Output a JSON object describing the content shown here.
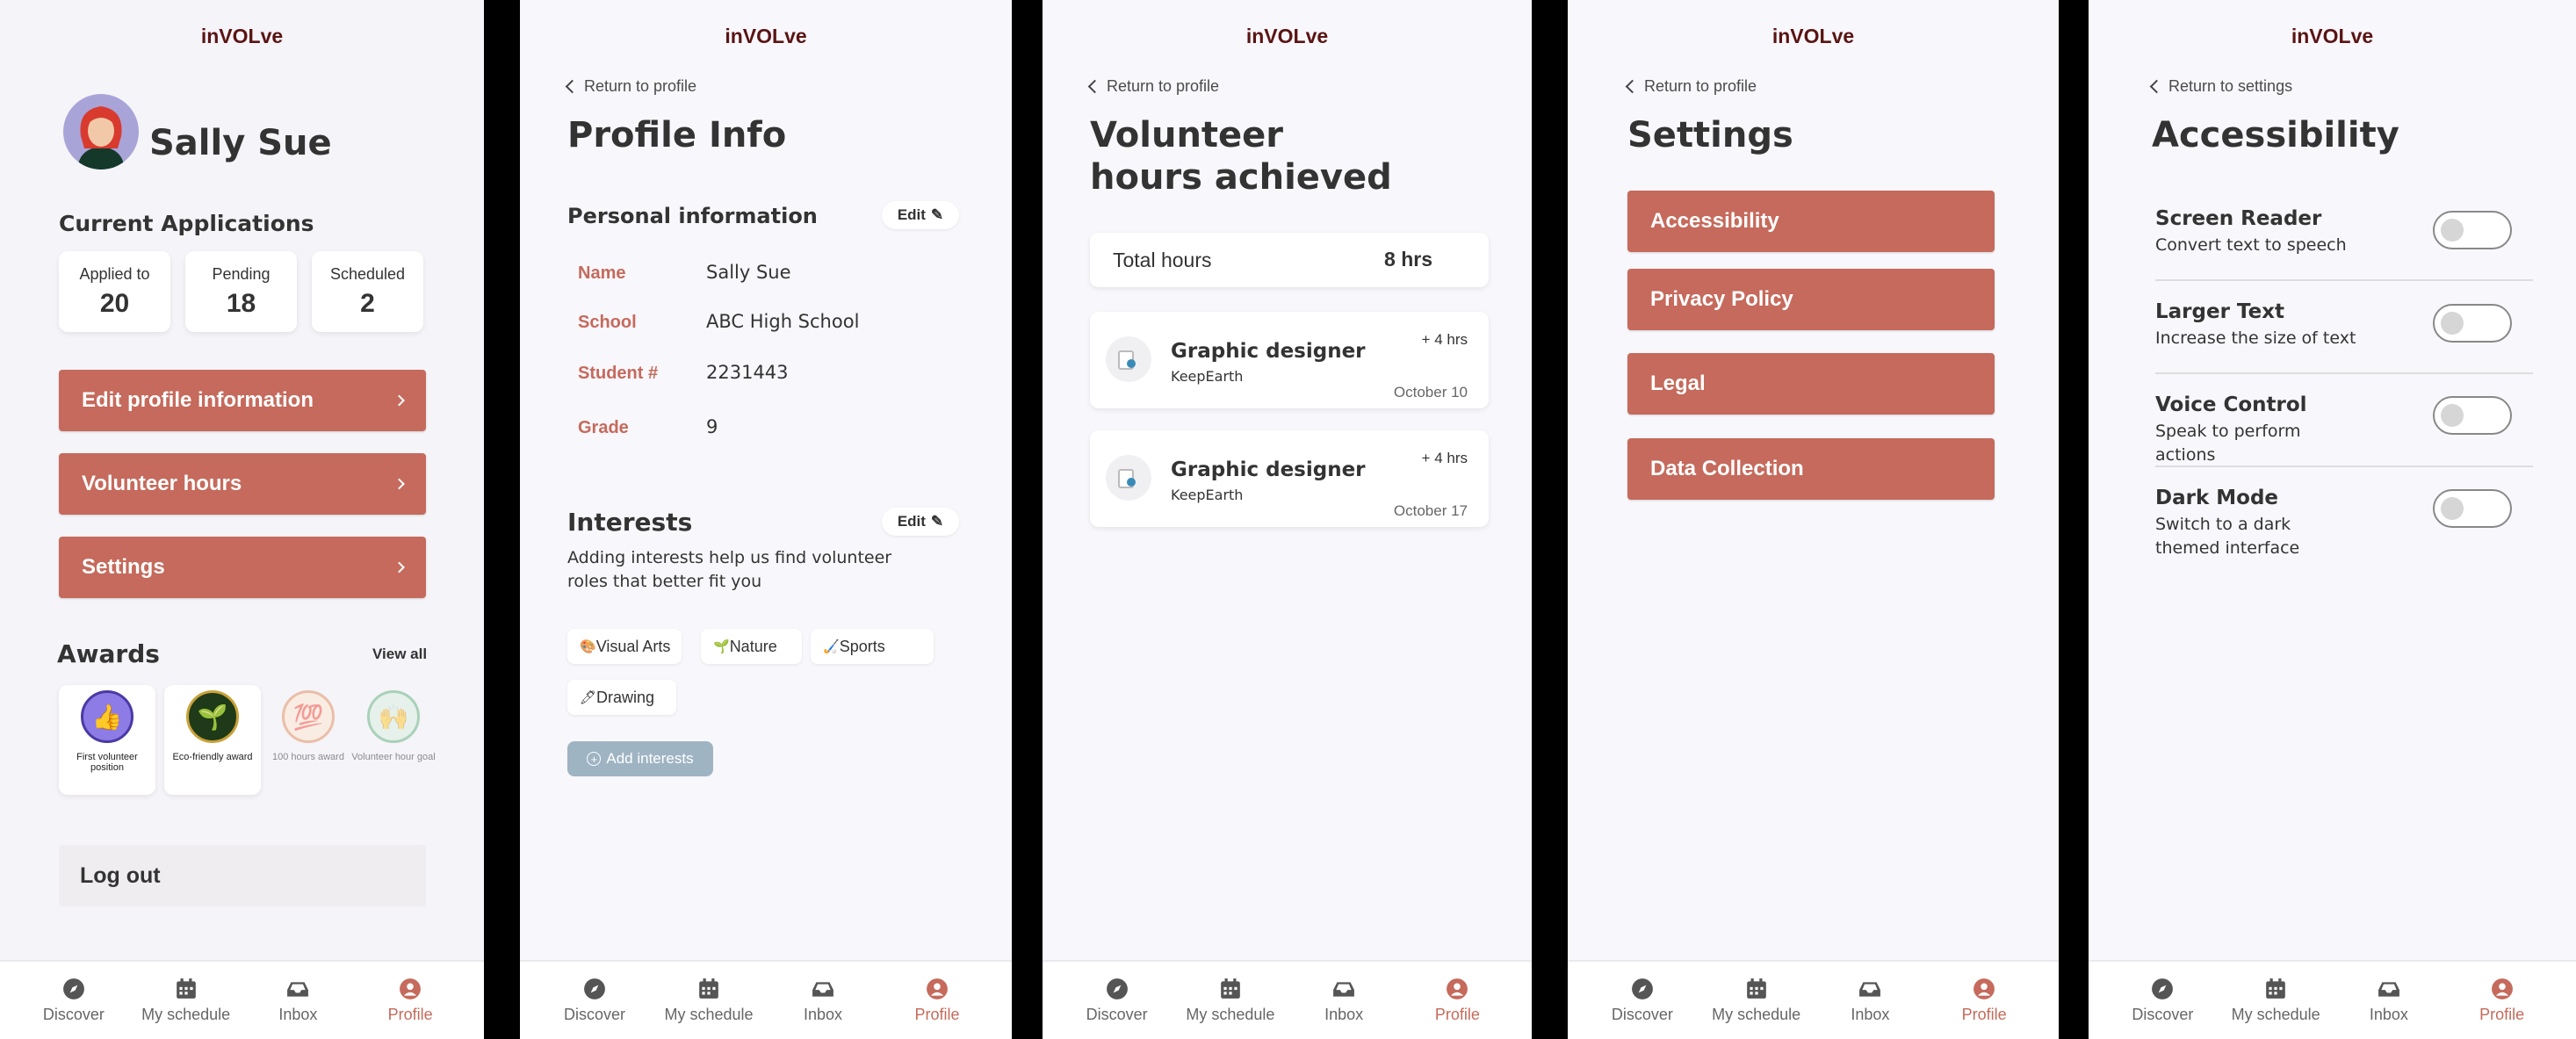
{
  "app_title": "inVOLve",
  "tabs": [
    {
      "label": "Discover",
      "icon": "compass-icon"
    },
    {
      "label": "My schedule",
      "icon": "calendar-icon"
    },
    {
      "label": "Inbox",
      "icon": "inbox-icon"
    },
    {
      "label": "Profile",
      "icon": "user-icon"
    }
  ],
  "colors": {
    "accent": "#c56a5c",
    "title": "#5a1414",
    "background": "#f8f7fb"
  },
  "profile": {
    "name": "Sally Sue",
    "applications_heading": "Current Applications",
    "stats": [
      {
        "label": "Applied to",
        "value": "20"
      },
      {
        "label": "Pending",
        "value": "18"
      },
      {
        "label": "Scheduled",
        "value": "2"
      }
    ],
    "buttons": [
      "Edit profile information",
      "Volunteer hours",
      "Settings"
    ],
    "awards_heading": "Awards",
    "view_all": "View all",
    "awards": [
      {
        "name": "First volunteer position",
        "icon": "thumbs-up-icon",
        "emoji": "👍"
      },
      {
        "name": "Eco-friendly award",
        "icon": "seedling-icon",
        "emoji": "🌱"
      },
      {
        "name": "100 hours award",
        "icon": "hundred-icon",
        "emoji": "💯"
      },
      {
        "name": "Volunteer hour goal",
        "icon": "raised-hands-icon",
        "emoji": "🙌"
      }
    ],
    "logout": "Log out"
  },
  "profile_info": {
    "back": "Return to profile",
    "title": "Profile Info",
    "personal_heading": "Personal information",
    "edit": "Edit",
    "fields": [
      {
        "key": "Name",
        "value": "Sally Sue"
      },
      {
        "key": "School",
        "value": "ABC High School"
      },
      {
        "key": "Student #",
        "value": "2231443"
      },
      {
        "key": "Grade",
        "value": "9"
      }
    ],
    "interests_heading": "Interests",
    "interests_desc": "Adding interests help us find volunteer roles that better fit you",
    "interests": [
      {
        "label": "Visual Arts",
        "emoji": "🎨"
      },
      {
        "label": "Nature",
        "emoji": "🌱"
      },
      {
        "label": "Sports",
        "emoji": "🏑"
      },
      {
        "label": "Drawing",
        "emoji": "🖊"
      }
    ],
    "add_interests": "Add interests"
  },
  "volunteer_hours": {
    "back": "Return to profile",
    "title_line1": "Volunteer",
    "title_line2": "hours achieved",
    "total_label": "Total hours",
    "total_value": "8 hrs",
    "entries": [
      {
        "role": "Graphic designer",
        "org": "KeepEarth",
        "hours": "+ 4 hrs",
        "date": "October 10"
      },
      {
        "role": "Graphic designer",
        "org": "KeepEarth",
        "hours": "+ 4 hrs",
        "date": "October 17"
      }
    ]
  },
  "settings": {
    "back": "Return to profile",
    "title": "Settings",
    "items": [
      "Accessibility",
      "Privacy Policy",
      "Legal",
      "Data Collection"
    ]
  },
  "accessibility": {
    "back": "Return to settings",
    "title": "Accessibility",
    "options": [
      {
        "title": "Screen Reader",
        "desc": "Convert text to speech",
        "on": false
      },
      {
        "title": "Larger Text",
        "desc": "Increase the size of text",
        "on": false
      },
      {
        "title": "Voice Control",
        "desc": "Speak to perform actions",
        "on": false
      },
      {
        "title": "Dark Mode",
        "desc": "Switch to a dark themed interface",
        "on": false
      }
    ]
  }
}
